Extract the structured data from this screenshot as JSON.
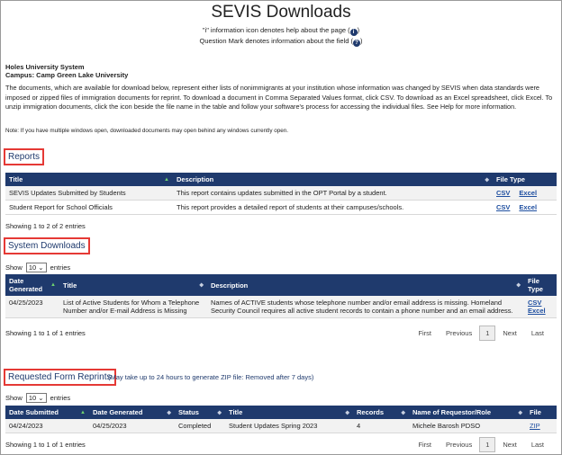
{
  "page": {
    "title": "SEVIS Downloads",
    "legend_info": "\"i\" information icon denotes help about the page (",
    "legend_info_end": ")",
    "legend_question": "Question Mark denotes information about the field (",
    "legend_question_end": ")",
    "org_name": "Holes University System",
    "campus": "Campus: Camp Green Lake University",
    "intro": "The documents, which are available for download below, represent either lists of nonimmigrants at your institution whose information was changed by SEVIS when data standards were imposed or zipped files of immigration documents for reprint. To download a document in Comma Separated Values format, click CSV. To download as an Excel spreadsheet, click Excel. To unzip immigration documents, click the icon beside the file name in the table and follow your software's process for accessing the individual files. See Help for more information.",
    "note": "Note: If you have multiple windows open, downloaded documents may open behind any windows currently open."
  },
  "icons": {
    "info": "i",
    "question": "?"
  },
  "reports": {
    "heading": "Reports",
    "columns": [
      "Title",
      "Description",
      "File Type"
    ],
    "rows": [
      {
        "title": "SEVIS Updates Submitted by Students",
        "description": "This report contains updates submitted in the OPT Portal by a student.",
        "csv": "CSV",
        "excel": "Excel"
      },
      {
        "title": "Student Report for School Officials",
        "description": "This report provides a detailed report of students at their campuses/schools.",
        "csv": "CSV",
        "excel": "Excel"
      }
    ],
    "info": "Showing 1 to 2 of 2 entries"
  },
  "system_downloads": {
    "heading": "System Downloads",
    "show_label": "Show",
    "show_value": "10",
    "entries_label": "entries",
    "columns": [
      "Date Generated",
      "Title",
      "Description",
      "File Type"
    ],
    "rows": [
      {
        "date": "04/25/2023",
        "title": "List of Active Students for Whom a Telephone Number and/or E-mail Address is Missing",
        "description": "Names of ACTIVE students whose telephone number and/or email address is missing. Homeland Security Council requires all active student records to contain a phone number and an email address.",
        "csv": "CSV",
        "excel": "Excel"
      }
    ],
    "info": "Showing 1 to 1 of 1 entries",
    "pager": {
      "first": "First",
      "previous": "Previous",
      "current": "1",
      "next": "Next",
      "last": "Last"
    }
  },
  "requested_reprints": {
    "heading": "Requested Form Reprints",
    "note": "(May take up to 24 hours to generate ZIP file: Removed after 7 days)",
    "show_label": "Show",
    "show_value": "10",
    "entries_label": "entries",
    "columns": [
      "Date Submitted",
      "Date Generated",
      "Status",
      "Title",
      "Records",
      "Name of Requestor/Role",
      "File"
    ],
    "rows": [
      {
        "submitted": "04/24/2023",
        "generated": "04/25/2023",
        "status": "Completed",
        "title": "Student Updates Spring 2023",
        "records": "4",
        "requestor": "Michele Barosh  PDSO",
        "file": "ZIP"
      }
    ],
    "info": "Showing 1 to 1 of 1 entries",
    "pager": {
      "first": "First",
      "previous": "Previous",
      "current": "1",
      "next": "Next",
      "last": "Last"
    }
  },
  "colors": {
    "header_bg": "#1f3a6d",
    "highlight_border": "#e53935",
    "link": "#1f4fa0"
  }
}
